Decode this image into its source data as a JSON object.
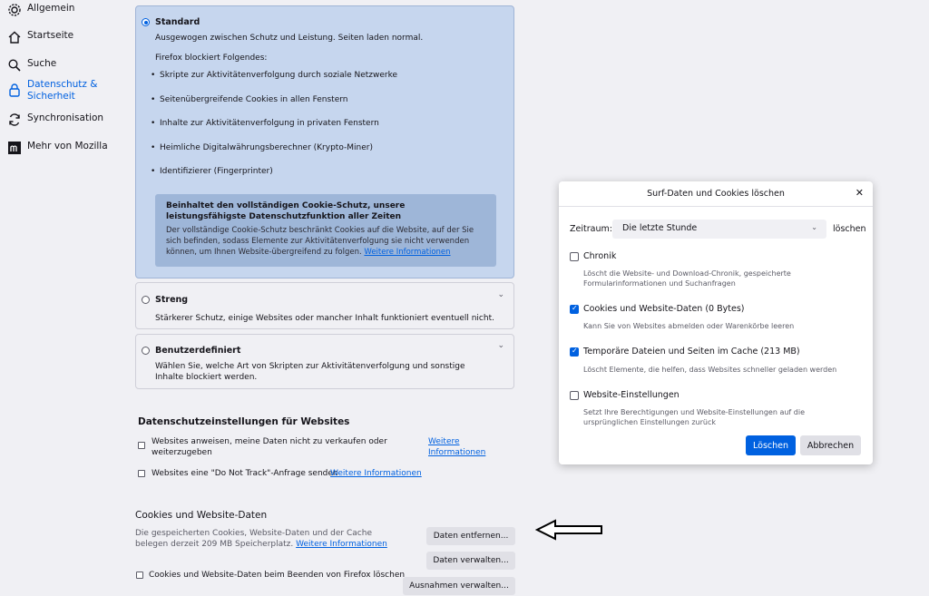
{
  "sidebar": {
    "items": [
      {
        "label": "Allgemein"
      },
      {
        "label": "Startseite"
      },
      {
        "label": "Suche"
      },
      {
        "label": "Datenschutz & Sicherheit"
      },
      {
        "label": "Synchronisation"
      },
      {
        "label": "Mehr von Mozilla"
      }
    ]
  },
  "tracking": {
    "standard": {
      "title": "Standard",
      "desc": "Ausgewogen zwischen Schutz und Leistung. Seiten laden normal.",
      "blocks_heading": "Firefox blockiert Folgendes:",
      "bullets": [
        "Skripte zur Aktivitätenverfolgung durch soziale Netzwerke",
        "Seitenübergreifende Cookies in allen Fenstern",
        "Inhalte zur Aktivitätenverfolgung in privaten Fenstern",
        "Heimliche Digitalwährungsberechner (Krypto-Miner)",
        "Identifizierer (Fingerprinter)"
      ],
      "info_heading": "Beinhaltet den vollständigen Cookie-Schutz, unsere leistungsfähigste Datenschutzfunktion aller Zeiten",
      "info_text": "Der vollständige Cookie-Schutz beschränkt Cookies auf die Website, auf der Sie sich befinden, sodass Elemente zur Aktivitätenverfolgung sie nicht verwenden können, um Ihnen Website-übergreifend zu folgen.",
      "info_link": "Weitere Informationen"
    },
    "strict": {
      "title": "Streng",
      "desc": "Stärkerer Schutz, einige Websites oder mancher Inhalt funktioniert eventuell nicht."
    },
    "custom": {
      "title": "Benutzerdefiniert",
      "desc": "Wählen Sie, welche Art von Skripten zur Aktivitätenverfolgung und sonstige Inhalte blockiert werden."
    }
  },
  "website_privacy": {
    "heading": "Datenschutzeinstellungen für Websites",
    "gpc_label": "Websites anweisen, meine Daten nicht zu verkaufen oder weiterzugeben",
    "gpc_link": "Weitere Informationen",
    "dnt_label": "Websites eine \"Do Not Track\"-Anfrage senden",
    "dnt_link": "Weitere Informationen"
  },
  "cookies": {
    "heading": "Cookies und Website-Daten",
    "desc": "Die gespeicherten Cookies, Website-Daten und der Cache belegen derzeit 209 MB Speicherplatz.",
    "link": "Weitere Informationen",
    "clear_button": "Daten entfernen...",
    "manage_button": "Daten verwalten...",
    "exceptions_button": "Ausnahmen verwalten...",
    "delete_on_close": "Cookies und Website-Daten beim Beenden von Firefox löschen"
  },
  "dialog": {
    "title": "Surf-Daten und Cookies löschen",
    "range_label": "Zeitraum:",
    "range_value": "Die letzte Stunde",
    "range_suffix": "löschen",
    "items": [
      {
        "label": "Chronik",
        "desc": "Löscht die Website- und Download-Chronik, gespeicherte Formularinformationen und Suchanfragen",
        "checked": false
      },
      {
        "label": "Cookies und Website-Daten (0 Bytes)",
        "desc": "Kann Sie von Websites abmelden oder Warenkörbe leeren",
        "checked": true
      },
      {
        "label": "Temporäre Dateien und Seiten im Cache (213 MB)",
        "desc": "Löscht Elemente, die helfen, dass Websites schneller geladen werden",
        "checked": true
      },
      {
        "label": "Website-Einstellungen",
        "desc": "Setzt Ihre Berechtigungen und Website-Einstellungen auf die ursprünglichen Einstellungen zurück",
        "checked": false
      }
    ],
    "confirm_button": "Löschen",
    "cancel_button": "Abbrechen"
  },
  "colors": {
    "accent": "#0061e0",
    "selected_card": "#c6d6ee",
    "info_box": "#9eb6d8"
  }
}
